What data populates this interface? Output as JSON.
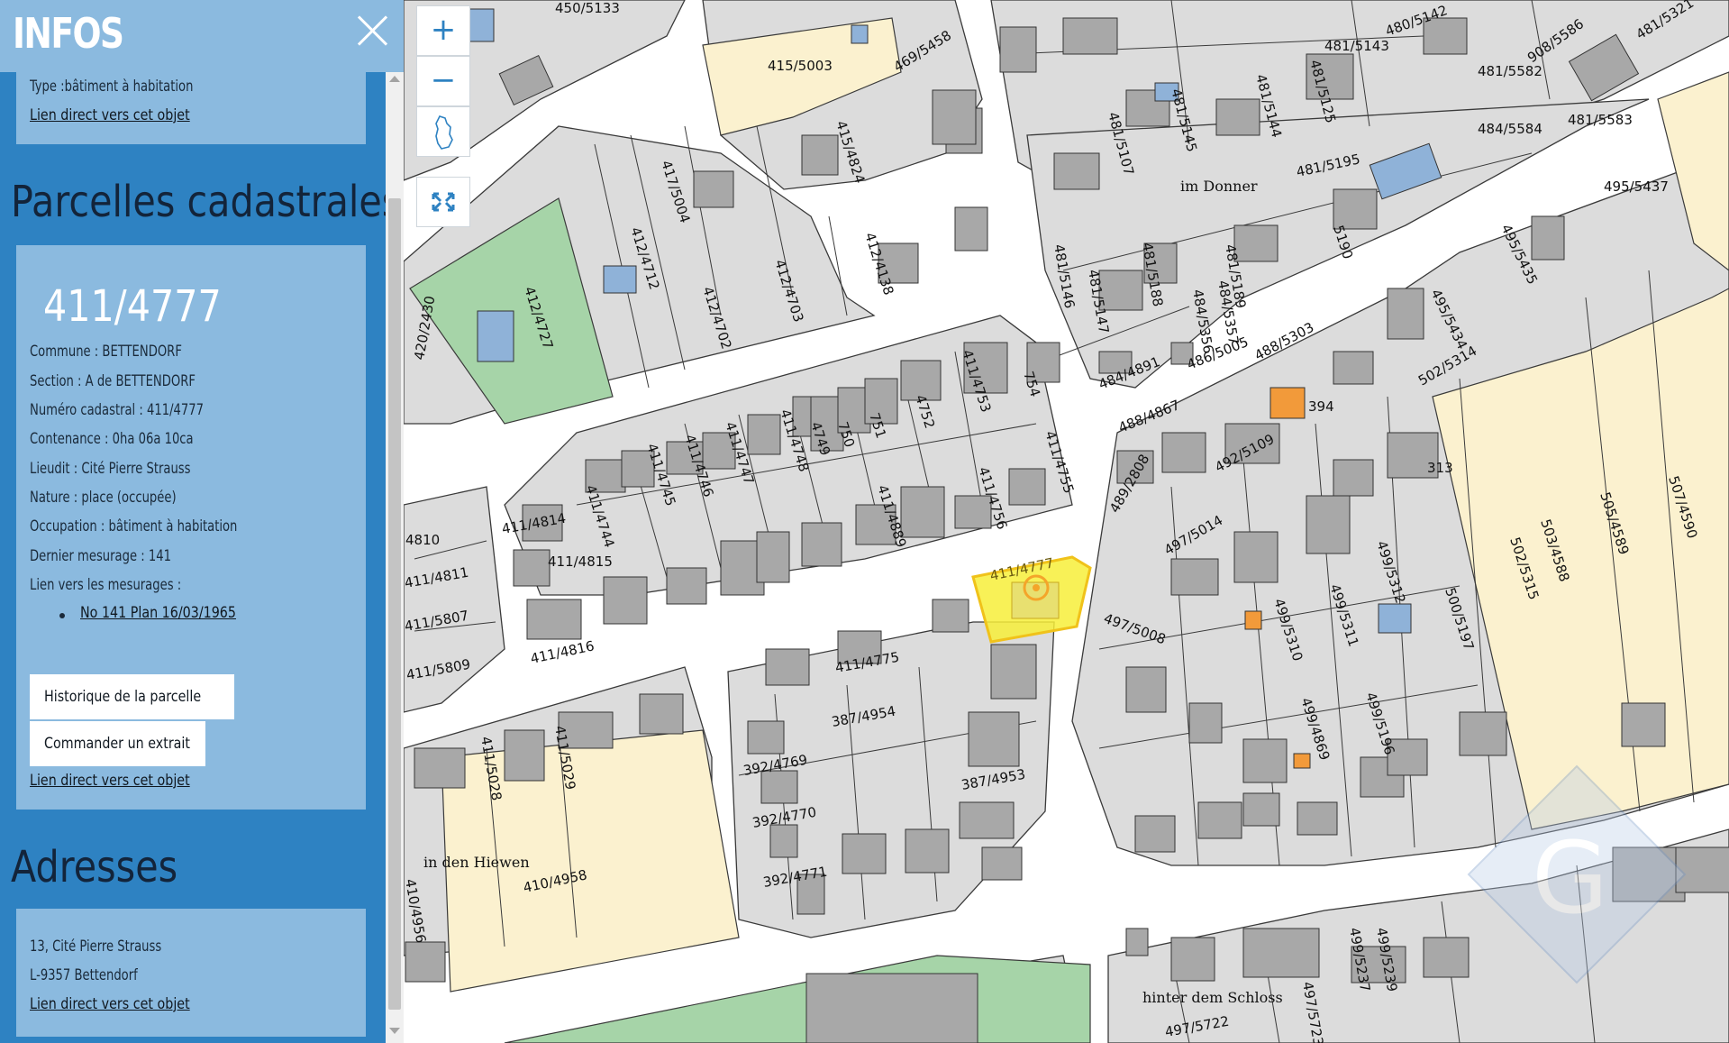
{
  "sidebar": {
    "title": "INFOS",
    "top_card": {
      "type_line": "Type :bâtiment à habitation",
      "link": "Lien direct vers cet objet"
    },
    "parcelles": {
      "heading": "Parcelles cadastrales",
      "parcel_id": "411/4777",
      "lines": [
        "Commune : BETTENDORF",
        "Section : A de BETTENDORF",
        "Numéro cadastral : 411/4777",
        "Contenance : 0ha 06a 10ca",
        "Lieudit : Cité Pierre Strauss",
        "Nature : place (occupée)",
        "Occupation : bâtiment à habitation",
        "Dernier mesurage : 141",
        "Lien vers les mesurages :"
      ],
      "measure_link": "No 141 Plan 16/03/1965",
      "history_button": "Historique de la parcelle",
      "order_button": "Commander un extrait",
      "link": "Lien direct vers cet objet"
    },
    "adresses": {
      "heading": "Adresses",
      "street": "13, Cité Pierre Strauss",
      "city": "L-9357 Bettendorf",
      "link": "Lien direct vers cet objet"
    }
  },
  "map": {
    "controls": {
      "zoom_in": "+",
      "zoom_out": "−",
      "extent_icon": "lux-outline-icon",
      "fullscreen_icon": "expand-icon"
    },
    "colors": {
      "parcel": "#dcdcdc",
      "road": "#ffffff",
      "building": "#a8a8a8",
      "beige": "#fbf1cf",
      "green": "#a6d4a8",
      "blue_building": "#8fb2d8",
      "orange_building": "#f29a3a",
      "highlight": "#f7ee3a",
      "highlight_marker": "#f4a52a"
    },
    "street_names": [
      "im Donner",
      "in den Hiewen",
      "hinter dem Schloss"
    ],
    "parcel_labels": [
      "450/5133",
      "415/5003",
      "469/5458",
      "481/5143",
      "480/5142",
      "481/5582",
      "908/5586",
      "481/5321",
      "481/5583",
      "484/5584",
      "481/5195",
      "495/5437",
      "415/4824",
      "417/5004",
      "412/4712",
      "412/4702",
      "412/4703",
      "412/4138",
      "412/4727",
      "420/2430",
      "411/4744",
      "411/4745",
      "411/4746",
      "411/4747",
      "411/4748",
      "4749",
      "750",
      "751",
      "4752",
      "411/4753",
      "754",
      "411/4755",
      "411/4756",
      "411/4889",
      "411/4814",
      "411/4815",
      "411/4816",
      "4810",
      "411/4811",
      "411/5807",
      "411/5809",
      "411/4777",
      "411/4775",
      "387/4954",
      "387/4953",
      "392/4769",
      "392/4770",
      "392/4771",
      "411/5028",
      "411/5029",
      "410/4958",
      "410/4956",
      "484/4891",
      "488/4867",
      "486/5005",
      "488/5303",
      "492/5109",
      "489/2808",
      "497/5014",
      "497/5008",
      "499/5310",
      "499/5311",
      "499/5312",
      "500/5197",
      "499/4869",
      "499/5196",
      "502/5314",
      "502/5315",
      "503/4588",
      "505/4589",
      "507/4590",
      "495/5434",
      "495/5435",
      "481/5107",
      "481/5145",
      "481/5144",
      "481/5125",
      "481/5188",
      "481/5189",
      "484/5356",
      "484/5357",
      "481/5146",
      "481/5147",
      "497/5722",
      "499/5239",
      "499/5237",
      "497/5723",
      "313",
      "5190",
      "394"
    ]
  }
}
